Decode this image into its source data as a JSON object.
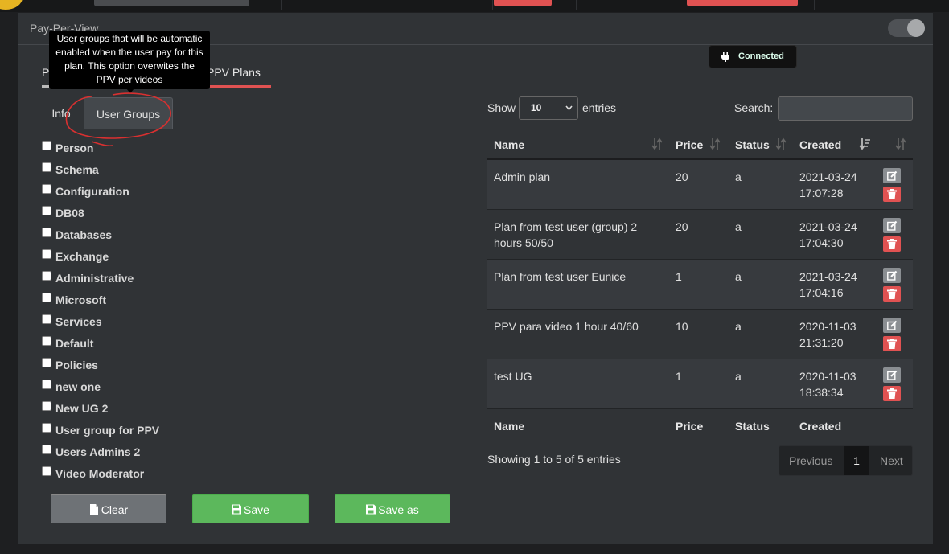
{
  "panel": {
    "title": "Pay-Per-View"
  },
  "outer_tabs": [
    "P",
    "PPV Plans"
  ],
  "tooltip": {
    "text": "User groups that will be automatic enabled when the user pay for this plan. This option overwites the PPV per videos"
  },
  "status": {
    "label": "Connected",
    "color": "#5cb85c"
  },
  "inner_tabs": [
    "Info",
    "User Groups"
  ],
  "user_groups": [
    "Person",
    "Schema",
    "Configuration",
    "DB08",
    "Databases",
    "Exchange",
    "Administrative",
    "Microsoft",
    "Services",
    "Default",
    "Policies",
    "new one",
    "New UG 2",
    "User group for PPV",
    "Users Admins 2",
    "Video Moderator"
  ],
  "buttons": {
    "clear": "Clear",
    "save": "Save",
    "save_as": "Save as"
  },
  "table_controls": {
    "show_label": "Show",
    "page_size": "10",
    "entries_label": "entries",
    "search_label": "Search:"
  },
  "table": {
    "columns": [
      "Name",
      "Price",
      "Status",
      "Created"
    ],
    "rows": [
      {
        "name": "Admin plan",
        "price": "20",
        "status": "a",
        "created_date": "2021-03-24",
        "created_time": "17:07:28"
      },
      {
        "name": "Plan from test user (group) 2",
        "name2": "hours 50/50",
        "price": "20",
        "status": "a",
        "created_date": "2021-03-24",
        "created_time": "17:04:30"
      },
      {
        "name": "Plan from test user Eunice",
        "price": "1",
        "status": "a",
        "created_date": "2021-03-24",
        "created_time": "17:04:16"
      },
      {
        "name": "PPV para video 1 hour 40/60",
        "price": "10",
        "status": "a",
        "created_date": "2020-11-03",
        "created_time": "21:31:20"
      },
      {
        "name": "test UG",
        "price": "1",
        "status": "a",
        "created_date": "2020-11-03",
        "created_time": "18:38:34"
      }
    ]
  },
  "table_info": "Showing 1 to 5 of 5 entries",
  "pagination": {
    "previous": "Previous",
    "current": "1",
    "next": "Next"
  },
  "colors": {
    "danger": "#e05252",
    "success": "#5cb85c",
    "annotation": "#d93030"
  }
}
